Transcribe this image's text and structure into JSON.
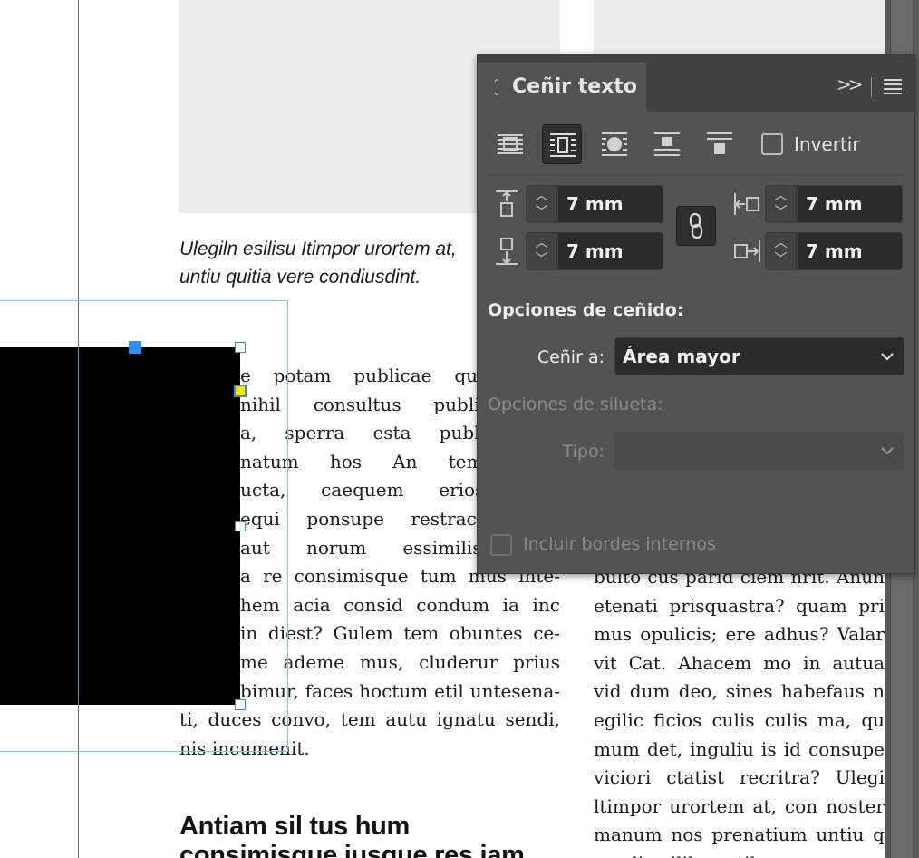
{
  "document": {
    "caption": [
      "Ulegiln esilisu Itimpor urortem at,",
      "untiu quitia vere condiusdint."
    ],
    "left_column": [
      "e potam publicae que re t",
      "nihil consultus publibus, s",
      "a, sperra esta publi impli",
      "natum hos An tem addu",
      "ucta, caequem eriostr itu",
      "equi ponsupe restrac re e",
      "aut norum essimilissus h",
      "a re consimisque tum mus inte-",
      "hem acia consid condum ia inc",
      " in diest? Gulem tem obuntes ce-",
      " me ademe mus, cluderur prius",
      "bimur, faces hoctum etil untesena-",
      "ti, duces convo, tem autu ignatu sendi,",
      "nis incumenit."
    ],
    "right_column": [
      "bulto cus parid ciem nrit. Anun",
      "etenati prisquastra? quam pri",
      "mus opulicis; ere adhus? Valar",
      "vit Cat. Ahacem mo in autua",
      "vid dum deo, sines habefaus n",
      "egilic ficios culis culis ma, qu",
      "mum det, inguliu is id consupe",
      "viciori ctatist recritra? Ulegi",
      "ltimpor urortem at, con noster",
      "manum nos prenatium untiu q",
      "condius ilibus etil"
    ],
    "heading": [
      "Antiam sil tus hum",
      "consimisque iusque res iam"
    ]
  },
  "panel": {
    "title": "Ceñir texto",
    "invert_label": "Invertir",
    "offsets": {
      "top": "7 mm",
      "bottom": "7 mm",
      "left": "7 mm",
      "right": "7 mm"
    },
    "wrap_options_heading": "Opciones de ceñido:",
    "wrap_to_label": "Ceñir a:",
    "wrap_to_value": "Área mayor",
    "contour_options_heading": "Opciones de silueta:",
    "type_label": "Tipo:",
    "type_value": "",
    "include_edges_label": "Incluir bordes internos"
  }
}
